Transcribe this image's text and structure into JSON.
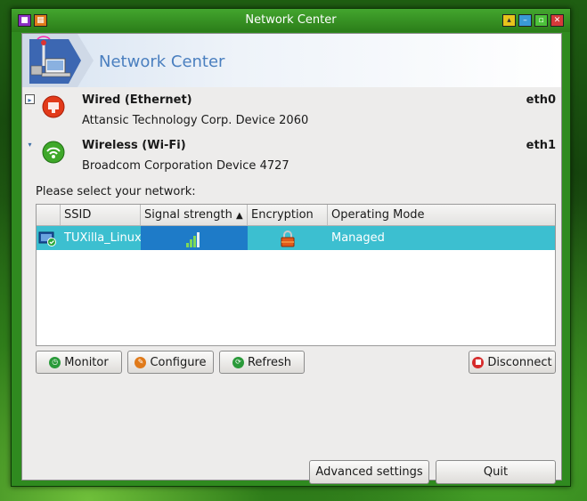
{
  "window": {
    "title": "Network Center"
  },
  "banner": {
    "title": "Network Center"
  },
  "devices": [
    {
      "name": "Wired (Ethernet)",
      "description": "Attansic Technology Corp. Device 2060",
      "interface": "eth0",
      "expanded": false,
      "icon": "wired-status-red-icon"
    },
    {
      "name": "Wireless (Wi-Fi)",
      "description": "Broadcom Corporation Device 4727",
      "interface": "eth1",
      "expanded": true,
      "icon": "wireless-status-green-icon"
    }
  ],
  "network_list": {
    "prompt": "Please select your network:",
    "columns": [
      "SSID",
      "Signal strength",
      "Encryption",
      "Operating Mode"
    ],
    "sort_indicator": "▲",
    "rows": [
      {
        "ssid": "TUXilla_Linux",
        "signal_strength": 0.8,
        "encryption": "lock-icon",
        "mode": "Managed"
      }
    ]
  },
  "buttons": {
    "monitor": "Monitor",
    "configure": "Configure",
    "refresh": "Refresh",
    "disconnect": "Disconnect",
    "advanced": "Advanced settings",
    "quit": "Quit"
  },
  "colors": {
    "selection": "#3cbfd0",
    "signal_cell": "#1e7bc8",
    "title_accent": "#4a7fbf"
  }
}
